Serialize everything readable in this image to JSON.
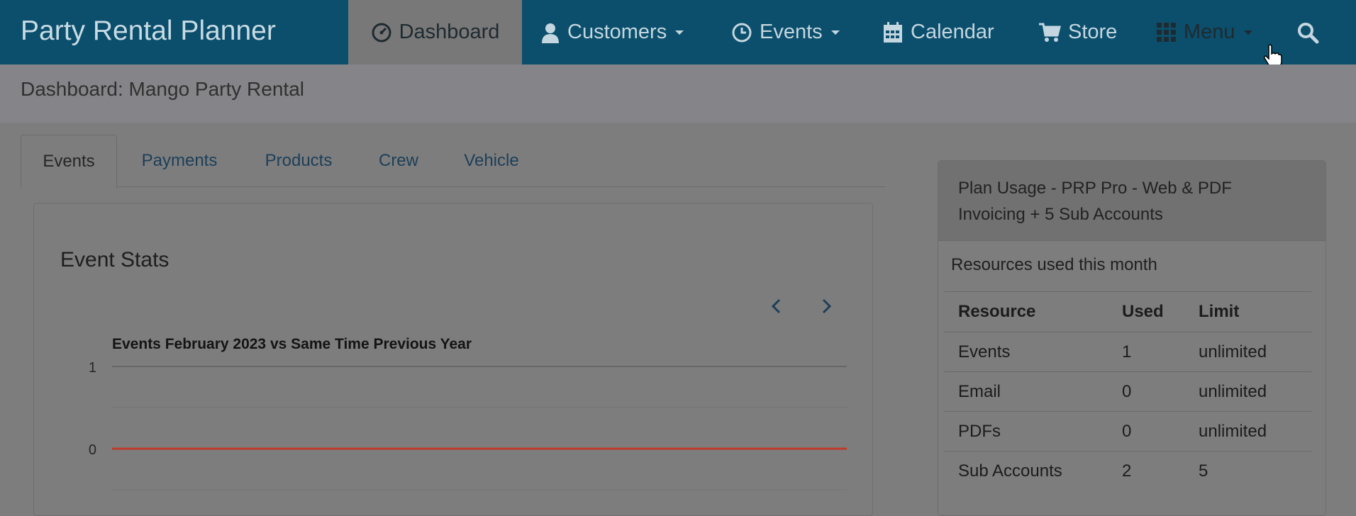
{
  "navbar": {
    "brand": "Party Rental Planner",
    "items": [
      {
        "label": "Dashboard",
        "icon": "dashboard-gauge-icon"
      },
      {
        "label": "Customers",
        "icon": "user-icon"
      },
      {
        "label": "Events",
        "icon": "clock-icon"
      },
      {
        "label": "Calendar",
        "icon": "calendar-icon"
      },
      {
        "label": "Store",
        "icon": "cart-icon"
      },
      {
        "label": "Menu",
        "icon": "grid-icon"
      }
    ],
    "search_icon": "search-icon"
  },
  "subheader": {
    "title": "Dashboard: Mango Party Rental"
  },
  "tabs": [
    {
      "label": "Events"
    },
    {
      "label": "Payments"
    },
    {
      "label": "Products"
    },
    {
      "label": "Crew"
    },
    {
      "label": "Vehicle"
    }
  ],
  "event_stats": {
    "title": "Event Stats"
  },
  "chart_data": {
    "type": "line",
    "title": "Events February 2023 vs Same Time Previous Year",
    "xlabel": "",
    "ylabel": "",
    "ylim": [
      0,
      1
    ],
    "yticks": [
      "1",
      "0"
    ],
    "grid": true,
    "series": [
      {
        "values": [
          0,
          0
        ],
        "color": "#c0392b"
      }
    ]
  },
  "plan": {
    "title": "Plan Usage - PRP Pro - Web & PDF Invoicing + 5 Sub Accounts",
    "subtitle": "Resources used this month",
    "columns": [
      "Resource",
      "Used",
      "Limit"
    ],
    "rows": [
      {
        "resource": "Events",
        "used": "1",
        "limit": "unlimited"
      },
      {
        "resource": "Email",
        "used": "0",
        "limit": "unlimited"
      },
      {
        "resource": "PDFs",
        "used": "0",
        "limit": "unlimited"
      },
      {
        "resource": "Sub Accounts",
        "used": "2",
        "limit": "5"
      }
    ]
  },
  "colors": {
    "navbar": "#0b4f6c",
    "link": "#1d3f58",
    "series_line": "#c0392b"
  }
}
